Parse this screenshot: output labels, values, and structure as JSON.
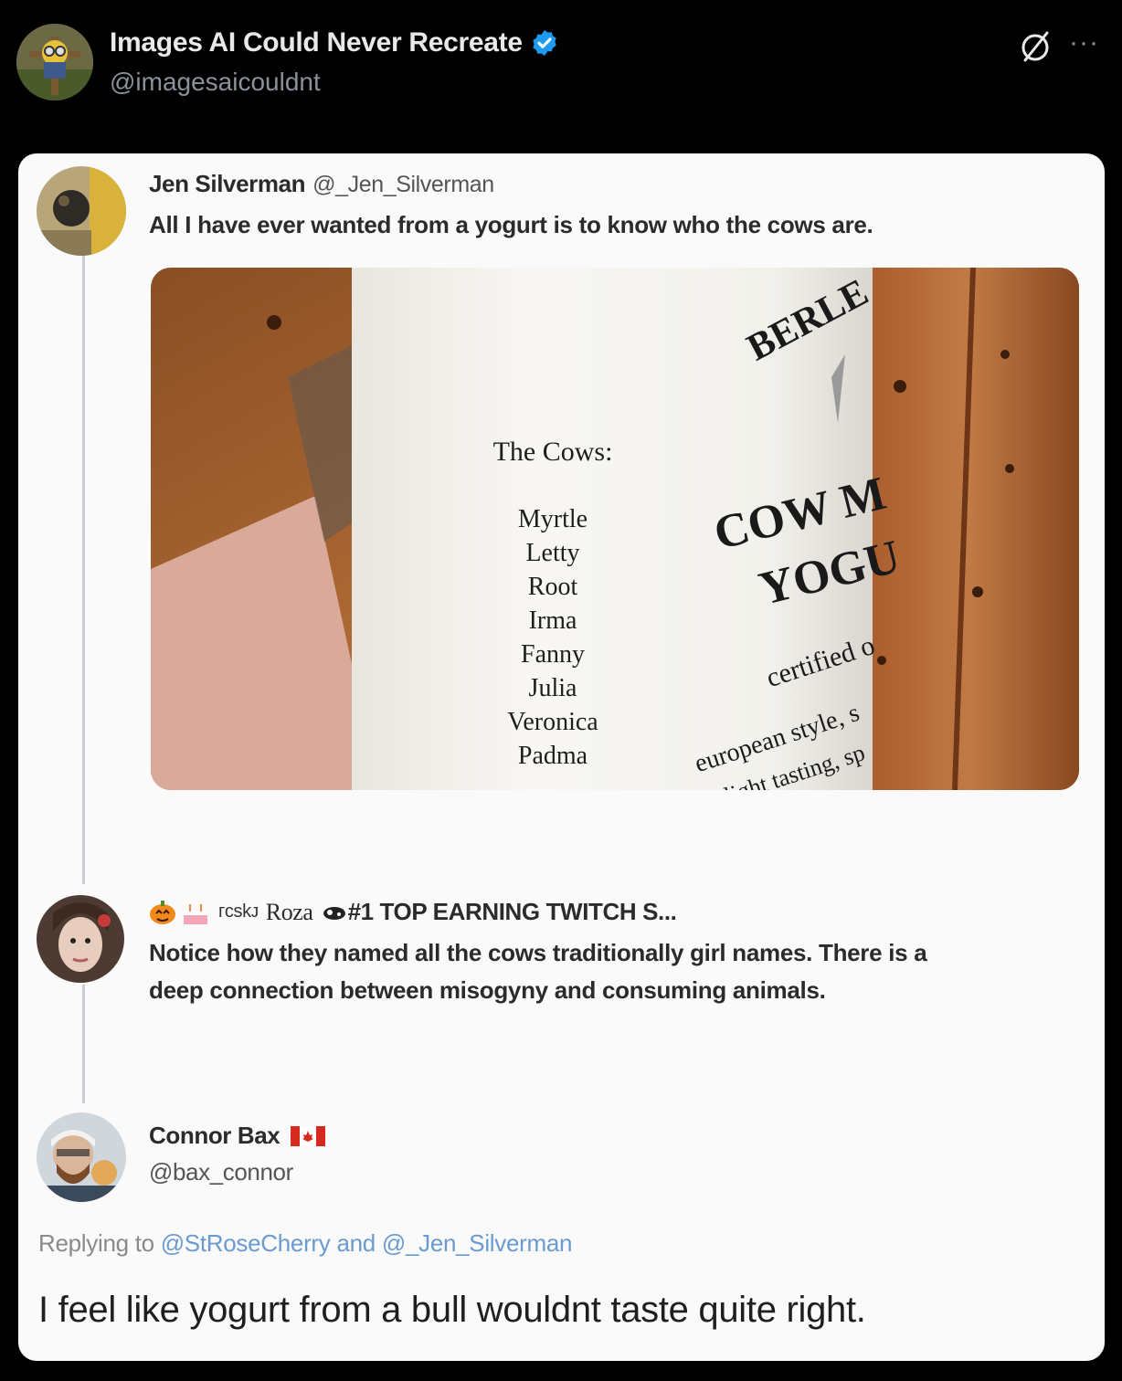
{
  "post": {
    "author_name": "Images AI Could Never Recreate",
    "author_handle": "@imagesaicouldnt",
    "more_label": "···",
    "colors": {
      "background": "#000000",
      "verified": "#1d9bf0"
    }
  },
  "card": {
    "tweet1": {
      "name": "Jen Silverman",
      "handle": "@_Jen_Silverman",
      "text": "All I have ever wanted from a yogurt is to know who the cows are.",
      "photo": {
        "cow_list_title": "The Cows:",
        "cows": [
          "Myrtle",
          "Letty",
          "Root",
          "Irma",
          "Fanny",
          "Julia",
          "Veronica",
          "Padma"
        ],
        "brand": "BERLE",
        "product_line1": "COW M",
        "product_line2": "YOGU",
        "certified": "certified o",
        "tagline1": "european style, s",
        "tagline2": "light tasting, sp"
      }
    },
    "tweet2": {
      "name_prefix": "ᴦcskᴊ",
      "name": "Roza",
      "name_suffix": "#1 TOP EARNING TWITCH S...",
      "text_line1": "Notice how they named all the cows traditionally girl names. There is a",
      "text_line2": "deep connection between misogyny and consuming animals."
    },
    "tweet3": {
      "name": "Connor Bax",
      "handle": "@bax_connor",
      "replying_prefix": "Replying to",
      "replying_mention1": "@StRoseCherry",
      "replying_and": "and",
      "replying_mention2": "@_Jen_Silverman",
      "text": "I feel like yogurt from a bull wouldnt taste quite right."
    }
  }
}
